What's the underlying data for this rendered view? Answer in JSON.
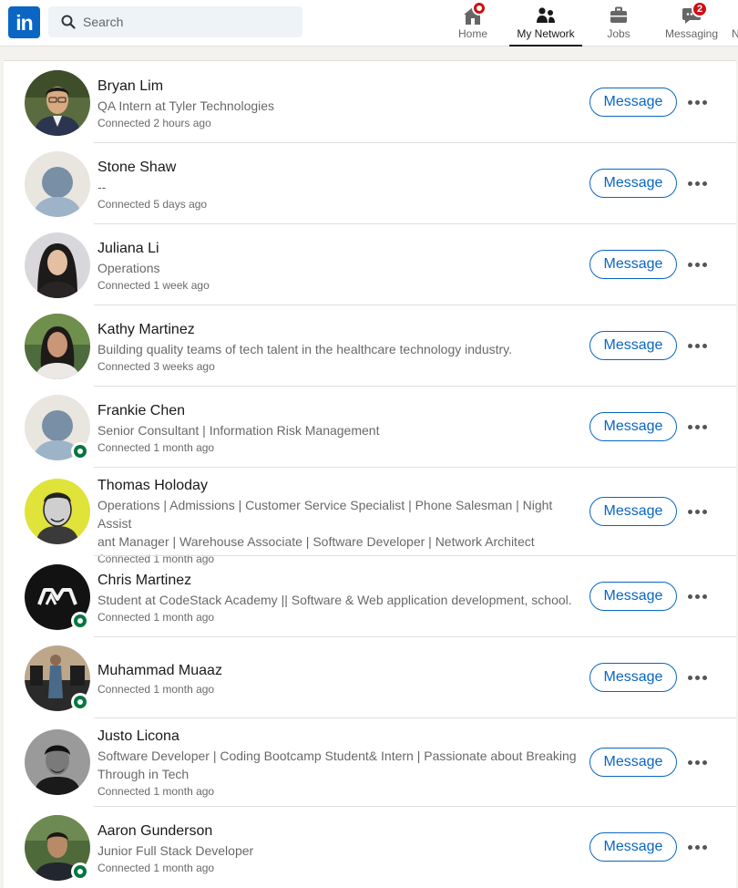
{
  "nav": {
    "logo_text": "in",
    "search_placeholder": "Search",
    "items": [
      {
        "label": "Home",
        "icon": "home-icon"
      },
      {
        "label": "My Network",
        "icon": "my-network-icon"
      },
      {
        "label": "Jobs",
        "icon": "jobs-icon"
      },
      {
        "label": "Messaging",
        "icon": "messaging-icon"
      },
      {
        "label": "N",
        "icon": "notifications-icon"
      }
    ],
    "messaging_badge": "2"
  },
  "connections": [
    {
      "name": "Bryan Lim",
      "headline_lines": [
        "QA Intern at Tyler Technologies"
      ],
      "time": "Connected 2 hours ago",
      "online": false
    },
    {
      "name": "Stone Shaw",
      "headline_lines": [
        "--"
      ],
      "time": "Connected 5 days ago",
      "online": false
    },
    {
      "name": "Juliana Li",
      "headline_lines": [
        "Operations"
      ],
      "time": "Connected 1 week ago",
      "online": false
    },
    {
      "name": "Kathy Martinez",
      "headline_lines": [
        "Building quality teams of tech talent in the healthcare technology industry."
      ],
      "time": "Connected 3 weeks ago",
      "online": false
    },
    {
      "name": "Frankie Chen",
      "headline_lines": [
        "Senior Consultant | Information Risk Management"
      ],
      "time": "Connected 1 month ago",
      "online": true
    },
    {
      "name": "Thomas Holoday",
      "headline_lines": [
        "Operations | Admissions | Customer Service Specialist | Phone Salesman | Night Assist",
        "ant Manager | Warehouse Associate | Software Developer | Network Architect"
      ],
      "time": "Connected 1 month ago",
      "online": false
    },
    {
      "name": "Chris Martinez",
      "headline_lines": [
        "Student at CodeStack Academy || Software & Web application development, school."
      ],
      "time": "Connected 1 month ago",
      "online": true
    },
    {
      "name": "Muhammad Muaaz",
      "headline_lines": [],
      "time": "Connected 1 month ago",
      "online": true
    },
    {
      "name": "Justo Licona",
      "headline_lines": [
        "Software Developer | Coding Bootcamp Student& Intern | Passionate about Breaking",
        "Through in Tech"
      ],
      "time": "Connected 1 month ago",
      "online": false
    },
    {
      "name": "Aaron Gunderson",
      "headline_lines": [
        "Junior Full Stack Developer"
      ],
      "time": "Connected 1 month ago",
      "online": true
    }
  ],
  "message_label": "Message",
  "colors": {
    "brand": "#0a66c2",
    "online": "#057642",
    "badge": "#cc1016"
  }
}
